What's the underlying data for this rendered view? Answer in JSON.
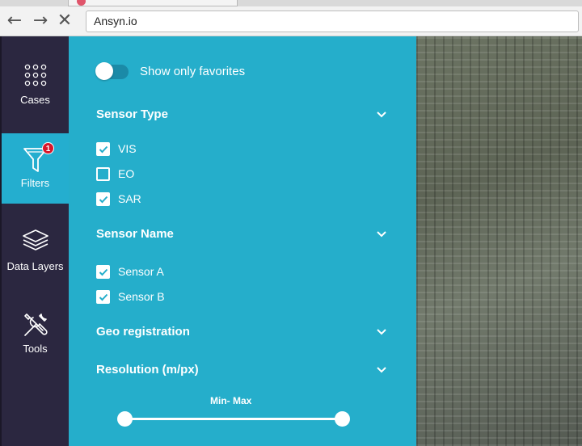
{
  "browser": {
    "url": "Ansyn.io",
    "back_icon": "arrow-left-icon",
    "forward_icon": "arrow-right-icon",
    "stop_icon": "close-icon"
  },
  "sidebar": {
    "items": [
      {
        "label": "Cases",
        "icon": "grid-dots-icon",
        "active": false
      },
      {
        "label": "Filters",
        "icon": "funnel-icon",
        "active": true,
        "badge": "1"
      },
      {
        "label": "Data Layers",
        "icon": "layers-icon",
        "active": false
      },
      {
        "label": "Tools",
        "icon": "tools-icon",
        "active": false
      }
    ]
  },
  "filters": {
    "favorites_label": "Show only favorites",
    "favorites_on": false,
    "sensor_type": {
      "title": "Sensor Type",
      "options": [
        {
          "label": "VIS",
          "checked": true
        },
        {
          "label": "EO",
          "checked": false
        },
        {
          "label": "SAR",
          "checked": true
        }
      ]
    },
    "sensor_name": {
      "title": "Sensor  Name",
      "options": [
        {
          "label": "Sensor A",
          "checked": true
        },
        {
          "label": "Sensor B",
          "checked": true
        }
      ]
    },
    "geo_registration": {
      "title": "Geo registration"
    },
    "resolution": {
      "title": "Resolution  (m/px)",
      "slider_label": "Min- Max"
    }
  },
  "colors": {
    "sidebar_bg": "#2b2740",
    "accent": "#25aecb",
    "badge": "#d8162a"
  }
}
